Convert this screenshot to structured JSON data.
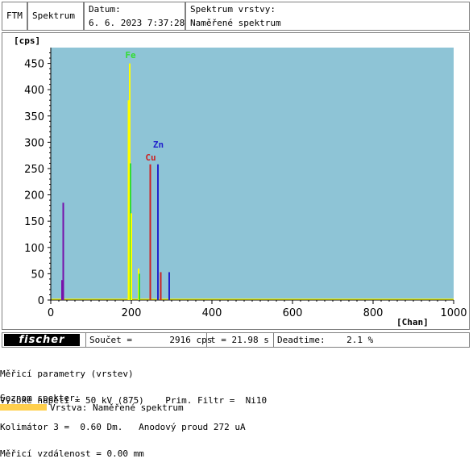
{
  "header": {
    "ftm": "FTM",
    "spektrum": "Spektrum",
    "date_label": "Datum:",
    "date_value": "6. 6. 2023 7:37:28",
    "sv_label": "Spektrum vrstvy:",
    "sv_value": "Naměřené spektrum"
  },
  "colors": {
    "plot_bg": "#8ec4d6",
    "fe": "#ffff00",
    "fe_green": "#33dd33",
    "cu": "#cc2222",
    "zn": "#2222cc",
    "purple": "#7711aa",
    "swatch": "#ffcf4d"
  },
  "chart_data": {
    "type": "bar",
    "ylabel": "[cps]",
    "xlabel": "[Chan]",
    "xlim": [
      0,
      1000
    ],
    "ylim": [
      0,
      480
    ],
    "xticks": [
      0,
      200,
      400,
      600,
      800,
      1000
    ],
    "yticks": [
      0,
      50,
      100,
      150,
      200,
      250,
      300,
      350,
      400,
      450
    ],
    "peaks": [
      {
        "x": 28,
        "y": 38,
        "color": "#7711aa"
      },
      {
        "x": 31,
        "y": 185,
        "color": "#7711aa"
      },
      {
        "x": 193,
        "y": 380,
        "color": "#ffff00"
      },
      {
        "x": 196,
        "y": 450,
        "color": "#ffff00"
      },
      {
        "x": 198,
        "y": 260,
        "color": "#33dd33"
      },
      {
        "x": 200,
        "y": 165,
        "color": "#ffff00"
      },
      {
        "x": 218,
        "y": 60,
        "color": "#ffff00"
      },
      {
        "x": 220,
        "y": 50,
        "color": "#33dd33"
      },
      {
        "x": 247,
        "y": 258,
        "color": "#cc2222"
      },
      {
        "x": 266,
        "y": 258,
        "color": "#2222cc"
      },
      {
        "x": 273,
        "y": 53,
        "color": "#cc2222"
      },
      {
        "x": 294,
        "y": 53,
        "color": "#2222cc"
      }
    ],
    "annotations": [
      {
        "text": "Fe",
        "x": 198,
        "y": 460,
        "color": "#33dd33"
      },
      {
        "text": "Cu",
        "x": 248,
        "y": 265,
        "color": "#cc2222"
      },
      {
        "text": "Zn",
        "x": 267,
        "y": 290,
        "color": "#2222cc"
      }
    ]
  },
  "footer": {
    "logo": "fischer",
    "soucet": "Součet =       2916 cps",
    "time": "t = 21.98 s",
    "deadtime": "Deadtime:    2.1 %"
  },
  "params": {
    "lines": [
      "Měřicí parametry (vrstev)",
      "Vysoké napětí = 50 kV (875)    Prim. Filtr =  Ni10",
      "Kolimátor 3 =  0.60 Dm.   Anodový proud 272 uA",
      "Měřicí vzdálenost = 0.00 mm"
    ]
  },
  "spectra": {
    "title": "Seznam spekter:",
    "item": "Vrstva: Naměřené spektrum"
  }
}
